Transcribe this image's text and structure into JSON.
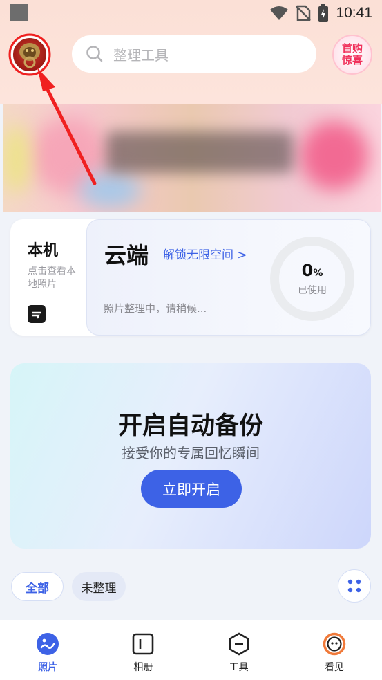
{
  "status_bar": {
    "time": "10:41"
  },
  "header": {
    "search_placeholder": "整理工具",
    "promo_line1": "首购",
    "promo_line2": "惊喜"
  },
  "storage": {
    "local_title": "本机",
    "local_subtitle": "点击查看本地照片",
    "cloud_title": "云端",
    "cloud_unlock": "解锁无限空间 >",
    "cloud_status": "照片整理中，请稍候...",
    "usage_value": "0",
    "usage_unit": "%",
    "usage_label": "已使用"
  },
  "backup": {
    "title": "开启自动备份",
    "subtitle": "接受你的专属回忆瞬间",
    "button": "立即开启"
  },
  "filters": {
    "all": "全部",
    "unsorted": "未整理"
  },
  "nav": [
    {
      "label": "照片"
    },
    {
      "label": "相册"
    },
    {
      "label": "工具"
    },
    {
      "label": "看见"
    }
  ],
  "colors": {
    "accent": "#3d62e6",
    "annotation_arrow": "#f02020"
  },
  "icons": [
    "avatar",
    "search-icon",
    "grid-icon",
    "photos-icon",
    "album-icon",
    "tools-icon",
    "discover-icon"
  ]
}
